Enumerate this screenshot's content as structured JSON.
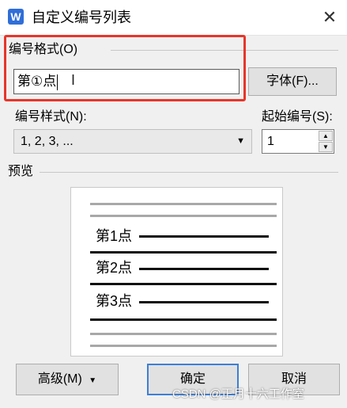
{
  "window": {
    "title": "自定义编号列表",
    "app_icon_letter": "W"
  },
  "format": {
    "group_label": "编号格式(O)",
    "value": "第①点",
    "font_button": "字体(F)..."
  },
  "style": {
    "label": "编号样式(N):",
    "selected": "1, 2, 3, ..."
  },
  "start": {
    "label": "起始编号(S):",
    "value": "1"
  },
  "preview": {
    "label": "预览",
    "items": [
      "第1点",
      "第2点",
      "第3点"
    ]
  },
  "buttons": {
    "advanced": "高级(M)",
    "ok": "确定",
    "cancel": "取消"
  },
  "watermark": "CSDN @正月十六工作室",
  "colors": {
    "highlight": "#e8352a",
    "accent": "#3c7fd6"
  },
  "icons": {
    "close": "close-icon",
    "dropdown": "chevron-down-icon",
    "spin_up": "triangle-up-icon",
    "spin_down": "triangle-down-icon"
  }
}
